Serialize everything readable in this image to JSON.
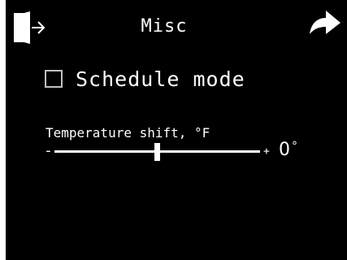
{
  "header": {
    "title": "Misc",
    "exit_icon": "exit-door-icon",
    "back_icon": "return-arrow-icon"
  },
  "schedule": {
    "label": "Schedule mode",
    "checked": false
  },
  "temperature_shift": {
    "label": "Temperature shift, °F",
    "minus_label": "-",
    "plus_label": "+",
    "value": "0",
    "unit": "°",
    "range_min": -10,
    "range_max": 10,
    "current": 0
  },
  "colors": {
    "background": "#000000",
    "foreground": "#ffffff",
    "checkbox_border": "#bfbfbf"
  }
}
